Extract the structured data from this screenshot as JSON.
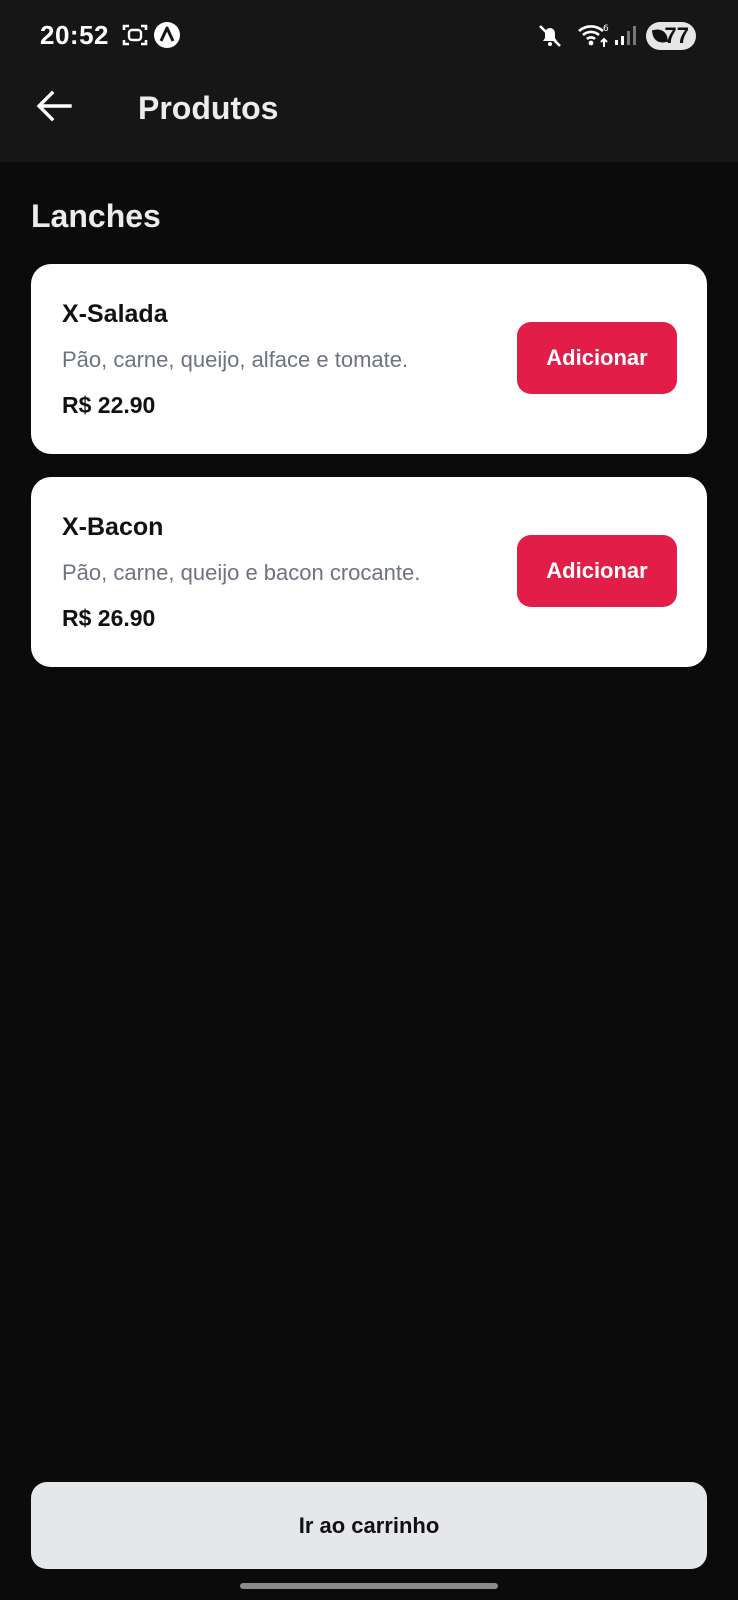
{
  "status_bar": {
    "time": "20:52",
    "battery": "77",
    "icons": [
      "screen-record-icon",
      "app-notification-icon",
      "mute-icon",
      "wifi-icon",
      "signal-icon",
      "battery-icon"
    ]
  },
  "app_bar": {
    "title": "Produtos",
    "back_icon": "arrow-left-icon"
  },
  "section": {
    "title": "Lanches"
  },
  "products": [
    {
      "name": "X-Salada",
      "description": "Pão, carne, queijo, alface e tomate.",
      "price": "R$ 22.90",
      "button_label": "Adicionar"
    },
    {
      "name": "X-Bacon",
      "description": "Pão, carne, queijo e bacon crocante.",
      "price": "R$ 26.90",
      "button_label": "Adicionar"
    }
  ],
  "cart_button": {
    "label": "Ir ao carrinho"
  },
  "colors": {
    "background": "#0b0b0b",
    "header": "#161616",
    "card": "#ffffff",
    "accent": "#e11d48",
    "muted_text": "#6e7380",
    "cart_button": "#e5e7eb"
  }
}
